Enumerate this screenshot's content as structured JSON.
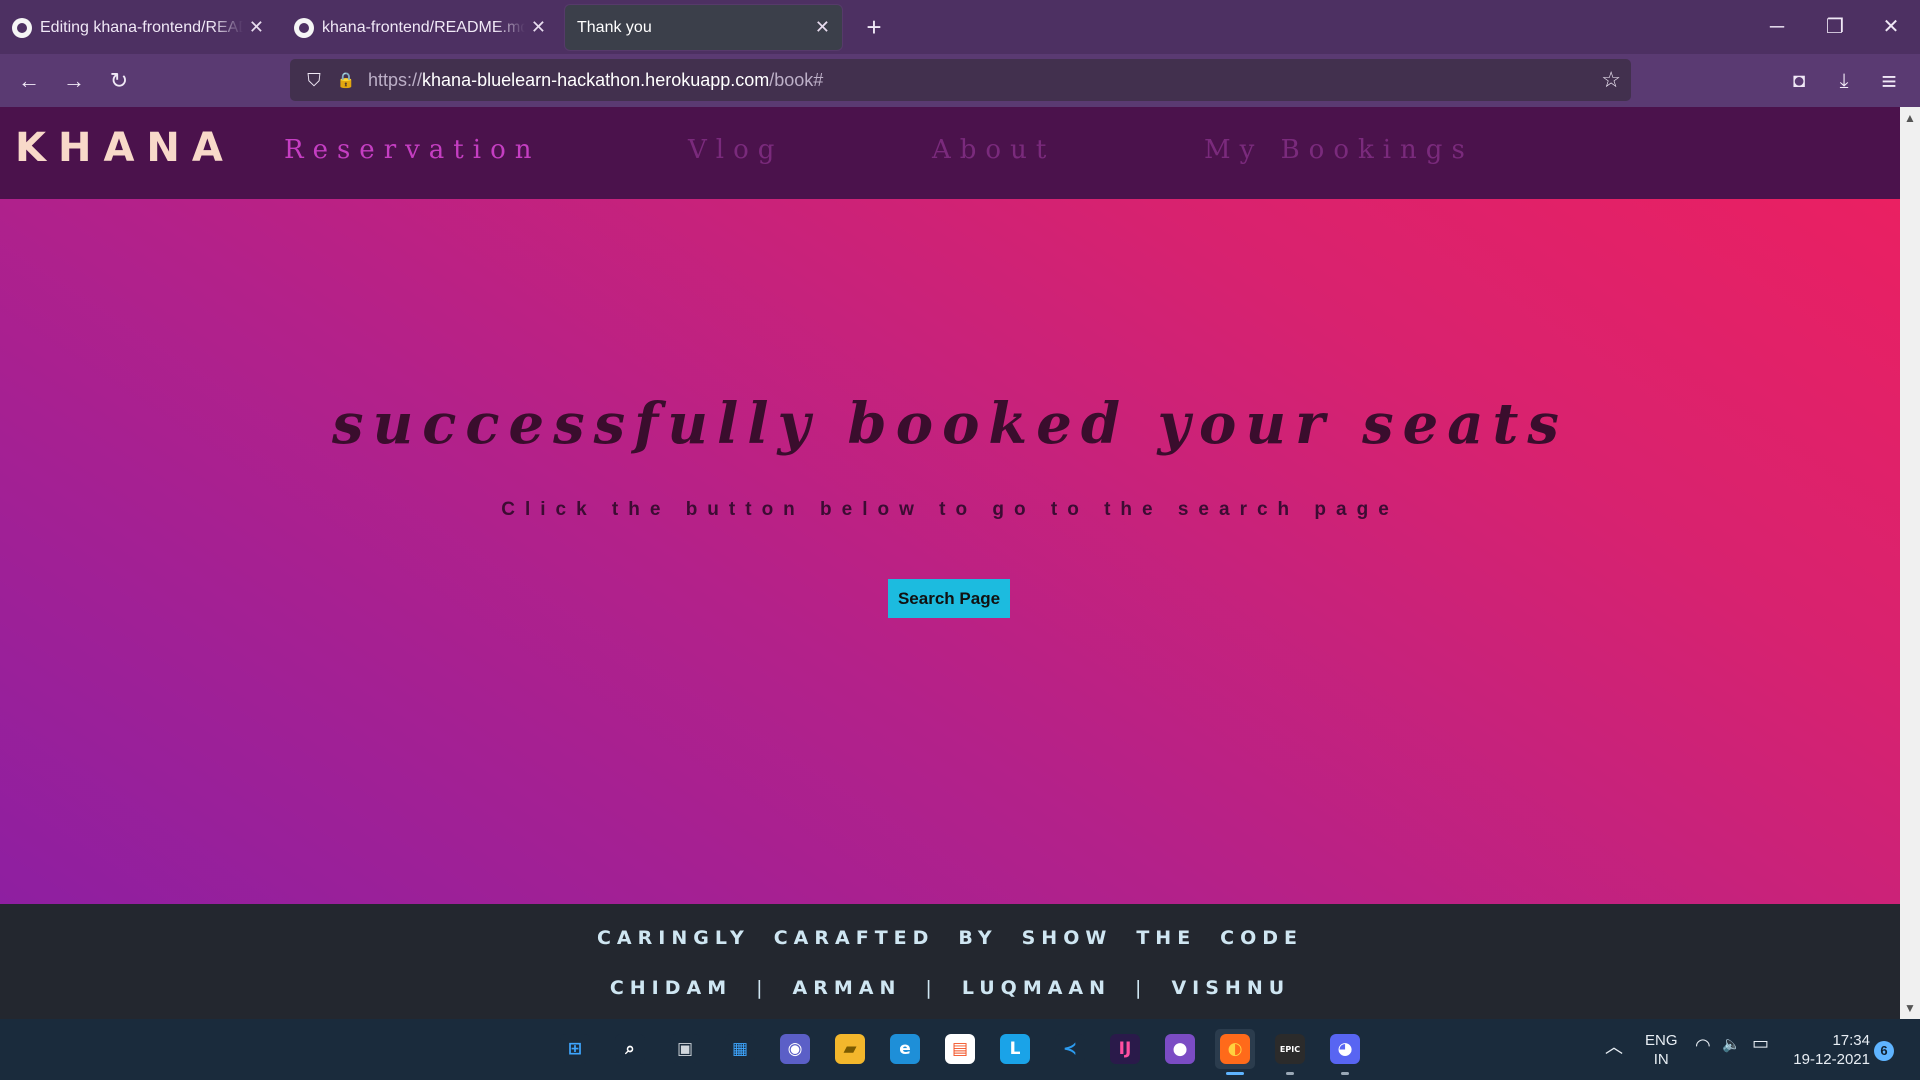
{
  "browser": {
    "tabs": [
      {
        "title": "Editing khana-frontend/README.md",
        "close": "✕",
        "icon": "github-icon"
      },
      {
        "title": "khana-frontend/README.md at main",
        "close": "✕",
        "icon": "github-icon"
      },
      {
        "title": "Thank you",
        "close": "✕",
        "active": true
      }
    ],
    "new_tab": "+",
    "window_controls": {
      "minimize": "─",
      "restore": "❐",
      "close": "✕"
    },
    "nav": {
      "back": "←",
      "forward": "→",
      "reload": "↻"
    },
    "url": {
      "scheme": "https://",
      "host": "khana-bluelearn-hackathon.herokuapp.com",
      "path": "/book#"
    },
    "url_icons": {
      "shield": "⛉",
      "lock": "🔒",
      "bookmark": "☆"
    },
    "toolbar_icons": {
      "pocket": "◘",
      "downloads": "⤓",
      "menu": "≡"
    }
  },
  "site": {
    "logo": "KHANA",
    "nav": [
      {
        "label": "Reservation",
        "color": "#c53ec2"
      },
      {
        "label": "Vlog",
        "color": "#7a2a7c"
      },
      {
        "label": "About",
        "color": "#7a2a7c"
      },
      {
        "label": "My Bookings",
        "color": "#7a2a7c"
      }
    ],
    "headline": "successfully booked your seats",
    "subline": "Click the button below to go to the search page",
    "button": "Search Page",
    "footer": {
      "line1": [
        "CARINGLY",
        "CARAFTED",
        "BY",
        "SHOW",
        "THE",
        "CODE"
      ],
      "line2": [
        "CHIDAM",
        "ARMAN",
        "LUQMAAN",
        "VISHNU"
      ],
      "separator": "|"
    }
  },
  "taskbar": {
    "apps": [
      {
        "name": "windows-start-icon",
        "glyph": "⊞",
        "bg": "#1a2b3c",
        "color": "#3ea6ff"
      },
      {
        "name": "search-icon",
        "glyph": "⌕",
        "bg": "#1a2b3c",
        "color": "#ffffff"
      },
      {
        "name": "task-view-icon",
        "glyph": "▣",
        "bg": "#1a2b3c",
        "color": "#d0d6dc"
      },
      {
        "name": "widgets-icon",
        "glyph": "▦",
        "bg": "#1a2b3c",
        "color": "#3ea6ff"
      },
      {
        "name": "teams-chat-icon",
        "glyph": "◉",
        "bg": "#5b5fc7",
        "color": "#ffffff"
      },
      {
        "name": "file-explorer-icon",
        "glyph": "▰",
        "bg": "#f3b72c",
        "color": "#7a5a00"
      },
      {
        "name": "edge-icon",
        "glyph": "e",
        "bg": "#1e8fd8",
        "color": "#ffffff"
      },
      {
        "name": "store-icon",
        "glyph": "▤",
        "bg": "#ffffff",
        "color": "#f25022"
      },
      {
        "name": "launcher-l-icon",
        "glyph": "L",
        "bg": "#1aa3e8",
        "color": "#ffffff"
      },
      {
        "name": "vscode-icon",
        "glyph": "≺",
        "bg": "#1a2b3c",
        "color": "#2c9cf0"
      },
      {
        "name": "intellij-icon",
        "glyph": "IJ",
        "bg": "#2a1a4a",
        "color": "#ff4fa0"
      },
      {
        "name": "github-desktop-icon",
        "glyph": "●",
        "bg": "#7b4cc4",
        "color": "#ffffff"
      },
      {
        "name": "firefox-icon",
        "glyph": "◐",
        "bg": "#ff6a1a",
        "color": "#ffd23f",
        "active": true
      },
      {
        "name": "epic-games-icon",
        "glyph": "EPIC",
        "bg": "#2b2b2b",
        "color": "#ffffff"
      },
      {
        "name": "discord-icon",
        "glyph": "◕",
        "bg": "#5865f2",
        "color": "#ffffff"
      }
    ],
    "tray": {
      "chevron": "︿",
      "wifi": "◠",
      "volume": "🔈",
      "battery": "▭"
    },
    "language": {
      "line1": "ENG",
      "line2": "IN"
    },
    "clock": {
      "time": "17:34",
      "date": "19-12-2021"
    },
    "notifications": "6"
  }
}
